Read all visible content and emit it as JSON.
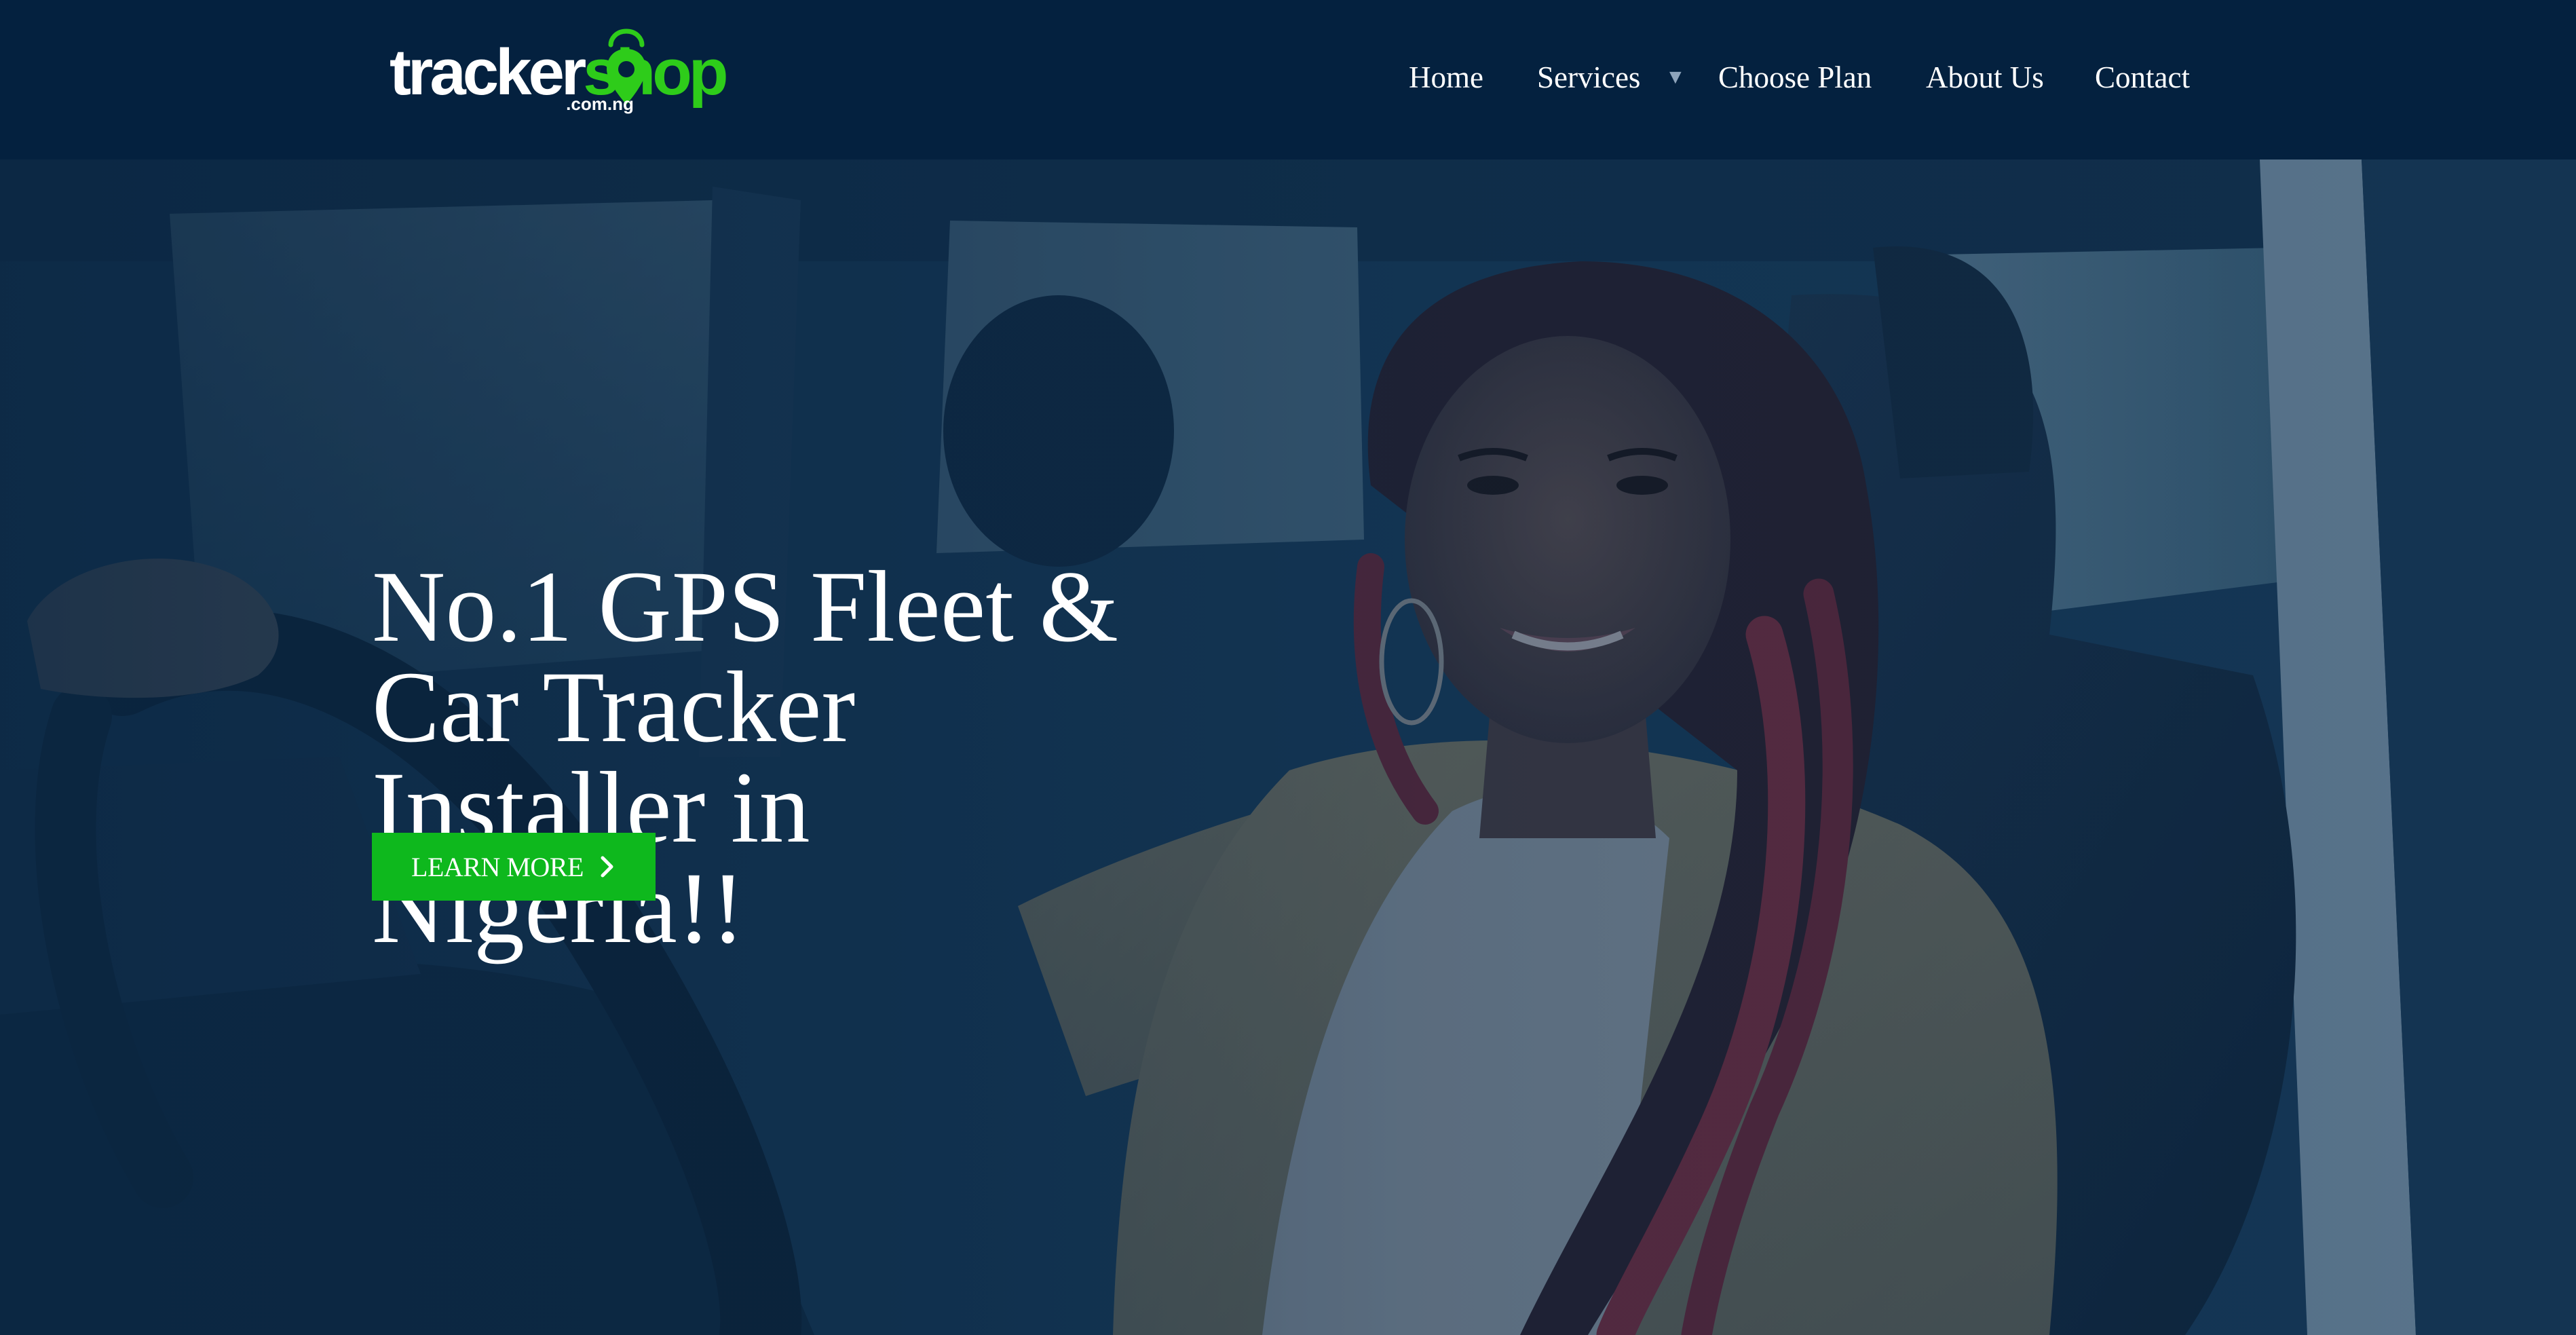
{
  "brand": {
    "name_part1": "tracker",
    "name_part2": "shop",
    "domain_suffix": ".com.ng",
    "accent_color": "#2ecc1a"
  },
  "nav": {
    "items": [
      {
        "label": "Home"
      },
      {
        "label": "Services",
        "has_dropdown": true,
        "dropdown_icon": "triangle-down-icon"
      },
      {
        "label": "Choose Plan"
      },
      {
        "label": "About Us"
      },
      {
        "label": "Contact"
      }
    ]
  },
  "hero": {
    "headline": "No.1 GPS Fleet & Car Tracker Installer in Nigeria!!",
    "cta_label": "LEARN MORE",
    "cta_icon": "chevron-right-icon",
    "cta_color": "#0eb81d",
    "overlay_color": "#0b2a48"
  },
  "header": {
    "background_color": "#04213f"
  }
}
